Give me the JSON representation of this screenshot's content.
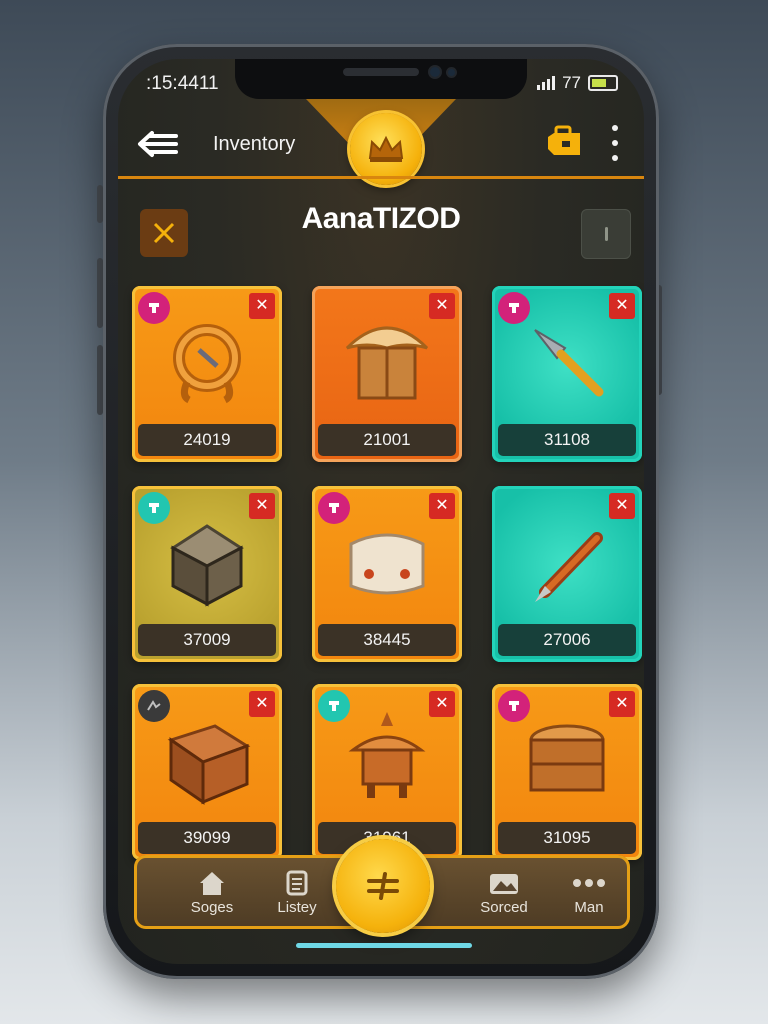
{
  "status": {
    "time": ":15:4411",
    "signal_text": "77"
  },
  "header": {
    "title": "Inventory",
    "back_icon": "back-arrow-icon",
    "crown_icon": "crown-icon",
    "bag_icon": "briefcase-icon",
    "more_icon": "more-vertical-icon"
  },
  "page": {
    "title": "AanaTIZOD"
  },
  "colors": {
    "accent": "#f5b10b",
    "orange_card": "#f79a17",
    "teal_card": "#17c0a8",
    "close": "#d62a23",
    "background": "#22241f"
  },
  "items": [
    {
      "value": "24019",
      "badge": "pink",
      "art": "ring-icon",
      "theme": "orange"
    },
    {
      "value": "21001",
      "badge": "none",
      "art": "tent-icon",
      "theme": "deep"
    },
    {
      "value": "31108",
      "badge": "pink",
      "art": "spear-icon",
      "theme": "teal"
    },
    {
      "value": "37009",
      "badge": "teal",
      "art": "stone-chest-icon",
      "theme": "olive"
    },
    {
      "value": "38445",
      "badge": "pink",
      "art": "cushion-icon",
      "theme": "orange"
    },
    {
      "value": "27006",
      "badge": "none",
      "art": "dagger-icon",
      "theme": "teal"
    },
    {
      "value": "39099",
      "badge": "dark",
      "art": "wooden-box-icon",
      "theme": "orange"
    },
    {
      "value": "31961",
      "badge": "teal",
      "art": "shrine-icon",
      "theme": "orange"
    },
    {
      "value": "31095",
      "badge": "pink",
      "art": "treasure-chest-icon",
      "theme": "orange"
    }
  ],
  "nav": [
    {
      "label": "Soges",
      "icon": "home-icon"
    },
    {
      "label": "Listey",
      "icon": "scroll-icon"
    },
    {
      "label": "Sorced",
      "icon": "photo-icon"
    },
    {
      "label": "Man",
      "icon": "more-horizontal-icon"
    }
  ],
  "fab": {
    "icon": "swap-icon"
  }
}
